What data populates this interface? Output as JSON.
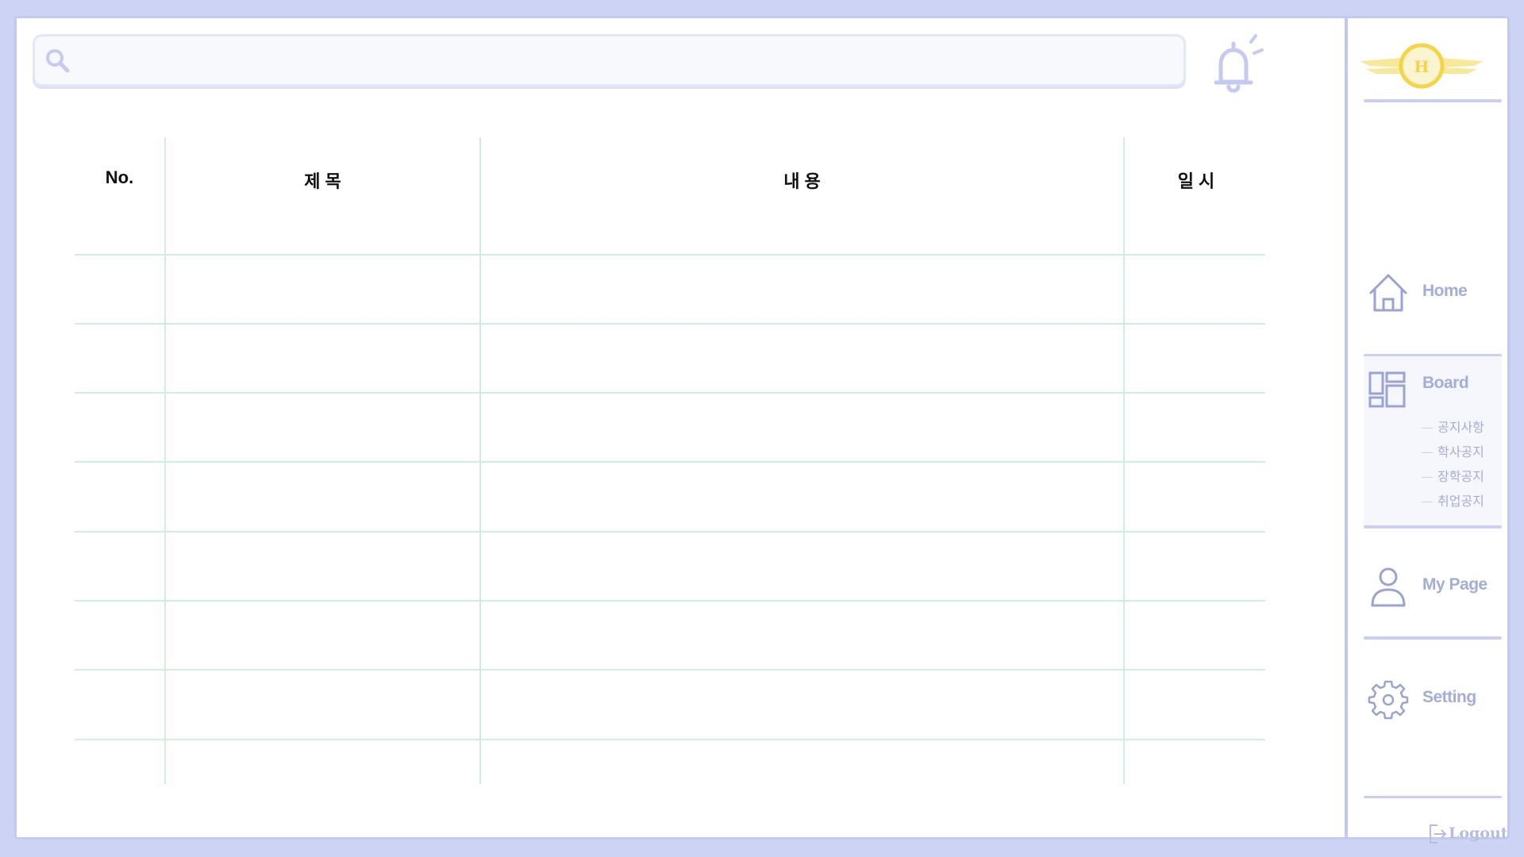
{
  "search": {
    "placeholder": "",
    "value": ""
  },
  "table": {
    "headers": [
      "No.",
      "제 목",
      "내 용",
      "일 시"
    ],
    "rows": [
      [
        "",
        "",
        "",
        ""
      ],
      [
        "",
        "",
        "",
        ""
      ],
      [
        "",
        "",
        "",
        ""
      ],
      [
        "",
        "",
        "",
        ""
      ],
      [
        "",
        "",
        "",
        ""
      ],
      [
        "",
        "",
        "",
        ""
      ],
      [
        "",
        "",
        "",
        ""
      ],
      [
        "",
        "",
        "",
        ""
      ]
    ]
  },
  "logo": {
    "letter": "H"
  },
  "nav": {
    "home": "Home",
    "board": "Board",
    "board_sub": [
      "공지사항",
      "학사공지",
      "장학공지",
      "취업공지"
    ],
    "mypage": "My Page",
    "setting": "Setting",
    "logout": "Logout"
  },
  "colors": {
    "background": "#cdd3f4",
    "accent": "#c3caef",
    "nav_text": "#a4acd9",
    "grid_line": "#cfeedd",
    "logo_gold": "#f5d547"
  },
  "icons": [
    "search-icon",
    "bell-icon",
    "home-icon",
    "board-icon",
    "user-icon",
    "gear-icon",
    "logout-icon"
  ]
}
